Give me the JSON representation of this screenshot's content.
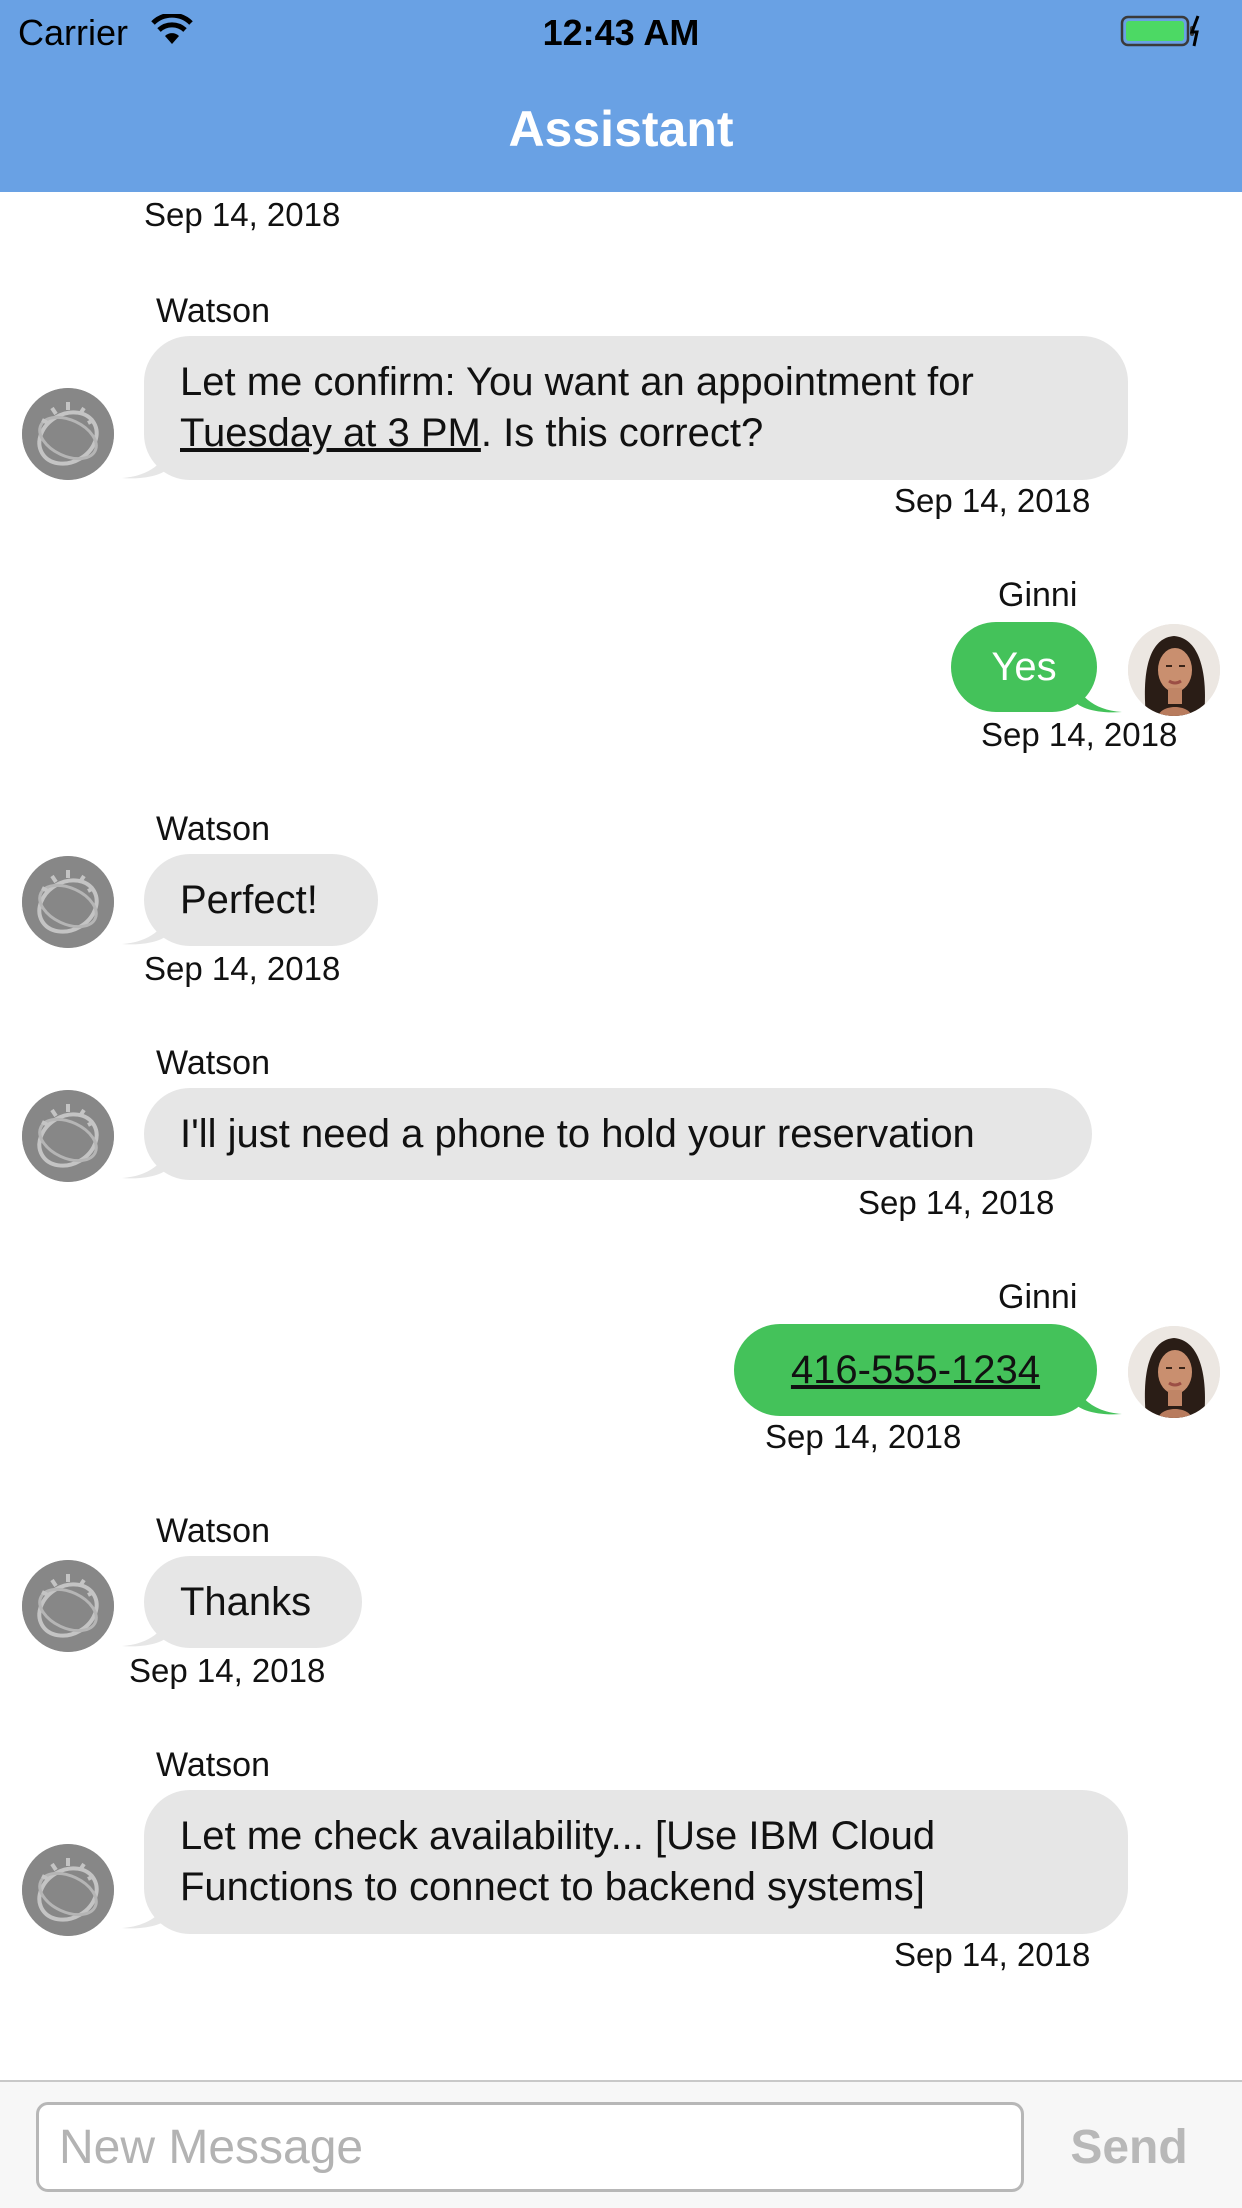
{
  "status_bar": {
    "carrier": "Carrier",
    "time": "12:43 AM",
    "icons": [
      "wifi-icon",
      "battery-icon",
      "charging-bolt-icon"
    ]
  },
  "nav": {
    "title": "Assistant"
  },
  "colors": {
    "header": "#69a1e4",
    "incoming_bubble": "#e6e6e6",
    "outgoing_bubble": "#44c25a",
    "send_disabled": "#b8b8b8"
  },
  "messages": [
    {
      "sender": "",
      "text": "",
      "time": "Sep 14, 2018",
      "direction": "out",
      "clipped": true
    },
    {
      "sender": "Watson",
      "text_before": "Let me confirm: You want an appointment for ",
      "text_link": "Tuesday at 3 PM",
      "text_after": ". Is this correct?",
      "time": "Sep 14, 2018",
      "direction": "in"
    },
    {
      "sender": "Ginni",
      "text": "Yes",
      "time": "Sep 14, 2018",
      "direction": "out"
    },
    {
      "sender": "Watson",
      "text": "Perfect!",
      "time": "Sep 14, 2018",
      "direction": "in"
    },
    {
      "sender": "Watson",
      "text": "I'll just need a phone to hold your reservation",
      "time": "Sep 14, 2018",
      "direction": "in"
    },
    {
      "sender": "Ginni",
      "text": "416-555-1234",
      "time": "Sep 14, 2018",
      "direction": "out",
      "is_link": true
    },
    {
      "sender": "Watson",
      "text": "Thanks",
      "time": "Sep 14, 2018",
      "direction": "in"
    },
    {
      "sender": "Watson",
      "text": "Let me check availability...  [Use IBM Cloud Functions to connect to backend systems]",
      "time": "Sep 14, 2018",
      "direction": "in"
    }
  ],
  "composer": {
    "placeholder": "New Message",
    "value": "",
    "send_label": "Send"
  }
}
